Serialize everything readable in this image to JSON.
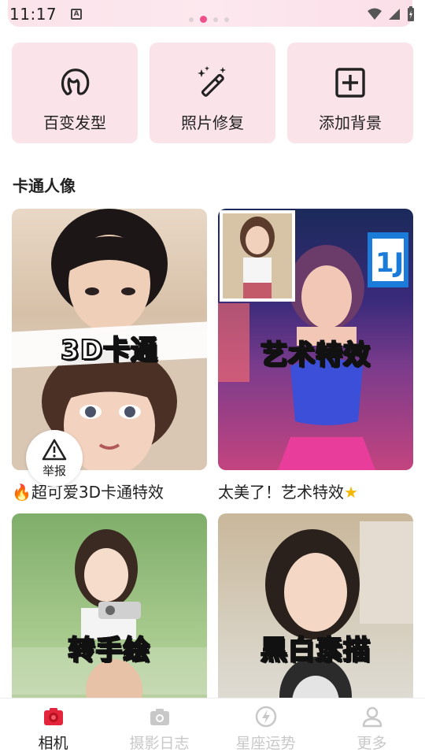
{
  "status_bar": {
    "time": "11:17",
    "notification_icon": "a-icon"
  },
  "banner": {
    "dots": 4,
    "active_dot": 1
  },
  "features": [
    {
      "label": "百变发型",
      "icon": "hair-icon"
    },
    {
      "label": "照片修复",
      "icon": "magic-wand-icon"
    },
    {
      "label": "添加背景",
      "icon": "add-box-icon"
    }
  ],
  "section": {
    "title": "卡通人像"
  },
  "cards": [
    {
      "overlay": "3D卡通",
      "caption": "超可爱3D卡通特效",
      "prefix_icon": "fire-icon"
    },
    {
      "overlay": "艺术特效",
      "caption": "太美了！艺术特效",
      "suffix_icon": "star-icon"
    },
    {
      "overlay": "转手绘",
      "caption": ""
    },
    {
      "overlay": "黑白素描",
      "caption": ""
    }
  ],
  "report": {
    "label": "举报"
  },
  "nav": [
    {
      "label": "相机",
      "icon": "camera-icon",
      "active": true
    },
    {
      "label": "摄影日志",
      "icon": "photo-log-icon",
      "active": false
    },
    {
      "label": "星座运势",
      "icon": "bolt-icon",
      "active": false
    },
    {
      "label": "更多",
      "icon": "user-icon",
      "active": false
    }
  ],
  "colors": {
    "accent": "#f0508a",
    "tile_bg": "#fbe3ea",
    "camera_red": "#e3243a"
  }
}
